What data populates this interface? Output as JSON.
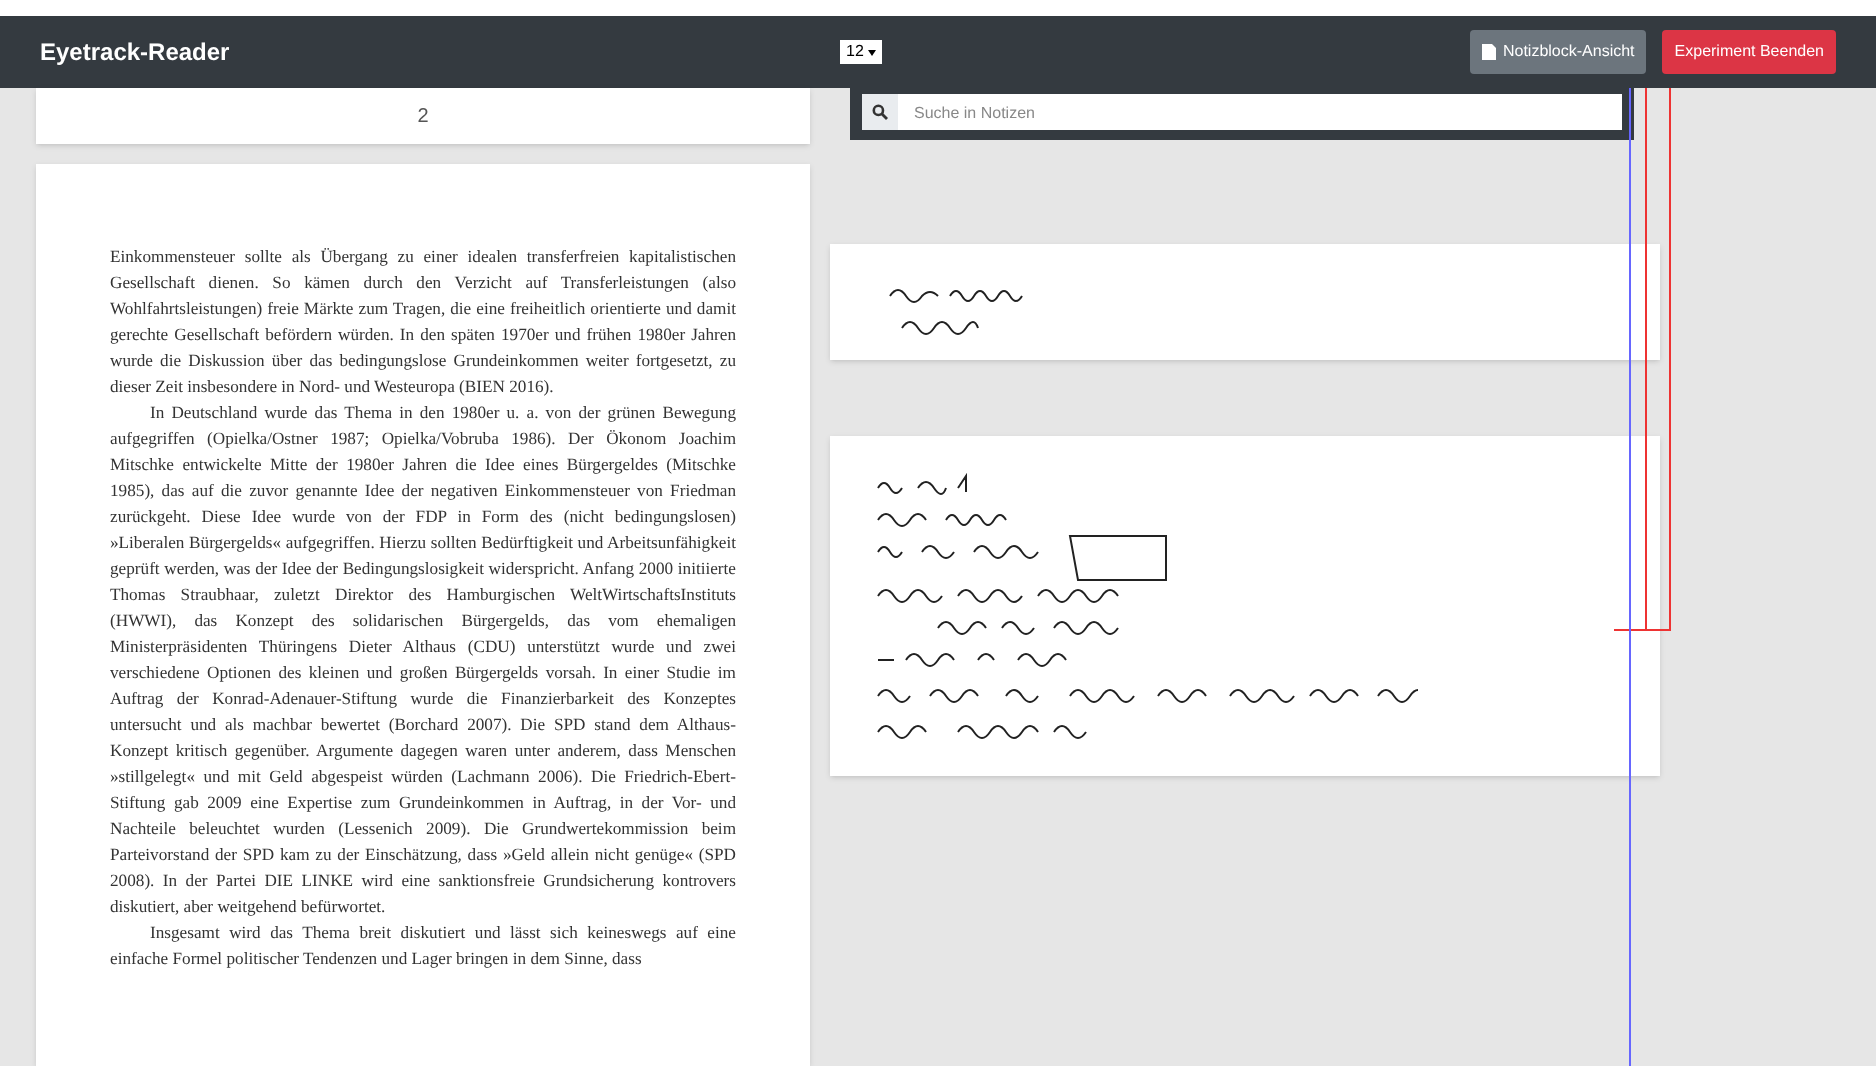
{
  "app": {
    "title": "Eyetrack-Reader",
    "font_size": "12",
    "buttons": [
      {
        "label": "Notizblock-Ansicht",
        "kind": "secondary"
      },
      {
        "label": "Experiment Beenden",
        "kind": "danger"
      }
    ]
  },
  "reader": {
    "page_number": "2",
    "paragraphs": [
      {
        "indent": false,
        "text": "Einkommensteuer sollte als Übergang zu einer idealen transferfreien kapitalistischen Gesellschaft dienen. So kämen durch den Verzicht auf Transferleistungen (also Wohlfahrtsleistungen) freie Märkte zum Tragen, die eine freiheitlich orientierte und damit gerechte Gesellschaft befördern würden. In den späten 1970er und frühen 1980er Jahren wurde die Diskussion über das bedingungslose Grundeinkommen weiter fortgesetzt, zu dieser Zeit insbesondere in Nord- und Westeuropa (BIEN 2016)."
      },
      {
        "indent": true,
        "text": "In Deutschland wurde das Thema in den 1980er u. a. von der grünen Bewegung aufgegriffen (Opielka/Ostner 1987; Opielka/Vobruba 1986). Der Ökonom Joachim Mitschke entwickelte Mitte der 1980er Jahren die Idee eines Bürgergeldes (Mitschke 1985), das auf die zuvor genannte Idee der negativen Einkommensteuer von Friedman zurückgeht. Diese Idee wurde von der FDP in Form des (nicht bedingungslosen) »Liberalen Bürgergelds« aufgegriffen. Hierzu sollten Bedürftigkeit und Arbeitsunfähigkeit geprüft werden, was der Idee der Bedingungslosigkeit widerspricht. Anfang 2000 initiierte Thomas Straubhaar, zuletzt Direktor des Hamburgischen WeltWirtschaftsInstituts (HWWI), das Konzept des solidarischen Bürgergelds, das vom ehemaligen Ministerpräsidenten Thüringens Dieter Althaus (CDU) unterstützt wurde und zwei verschiedene Optionen des kleinen und großen Bürgergelds vorsah. In einer Studie im Auftrag der Konrad-Adenauer-Stiftung wurde die Finanzierbarkeit des Konzeptes untersucht und als machbar bewertet (Borchard 2007). Die SPD stand dem Althaus- Konzept kritisch gegenüber. Argumente dagegen waren unter anderem, dass Menschen »stillgelegt« und mit Geld abgespeist würden (Lachmann 2006). Die Friedrich-Ebert-Stiftung gab 2009 eine Expertise zum Grundeinkommen in Auftrag, in der Vor- und Nachteile beleuchtet wurden (Lessenich 2009). Die Grundwertekommission beim Parteivorstand der SPD kam zu der Einschätzung, dass »Geld allein nicht genüge« (SPD 2008). In der Partei DIE LINKE wird eine sanktionsfreie Grundsicherung kontrovers diskutiert, aber weitgehend befürwortet."
      },
      {
        "indent": true,
        "text": "Insgesamt wird das Thema breit diskutiert und lässt sich keineswegs auf eine einfache Formel politischer Tendenzen und Lager bringen in dem Sinne, dass"
      }
    ]
  },
  "notes": {
    "search": {
      "placeholder": "Suche in Notizen"
    },
    "items": [
      {
        "kind": "short"
      },
      {
        "kind": "long"
      }
    ]
  }
}
